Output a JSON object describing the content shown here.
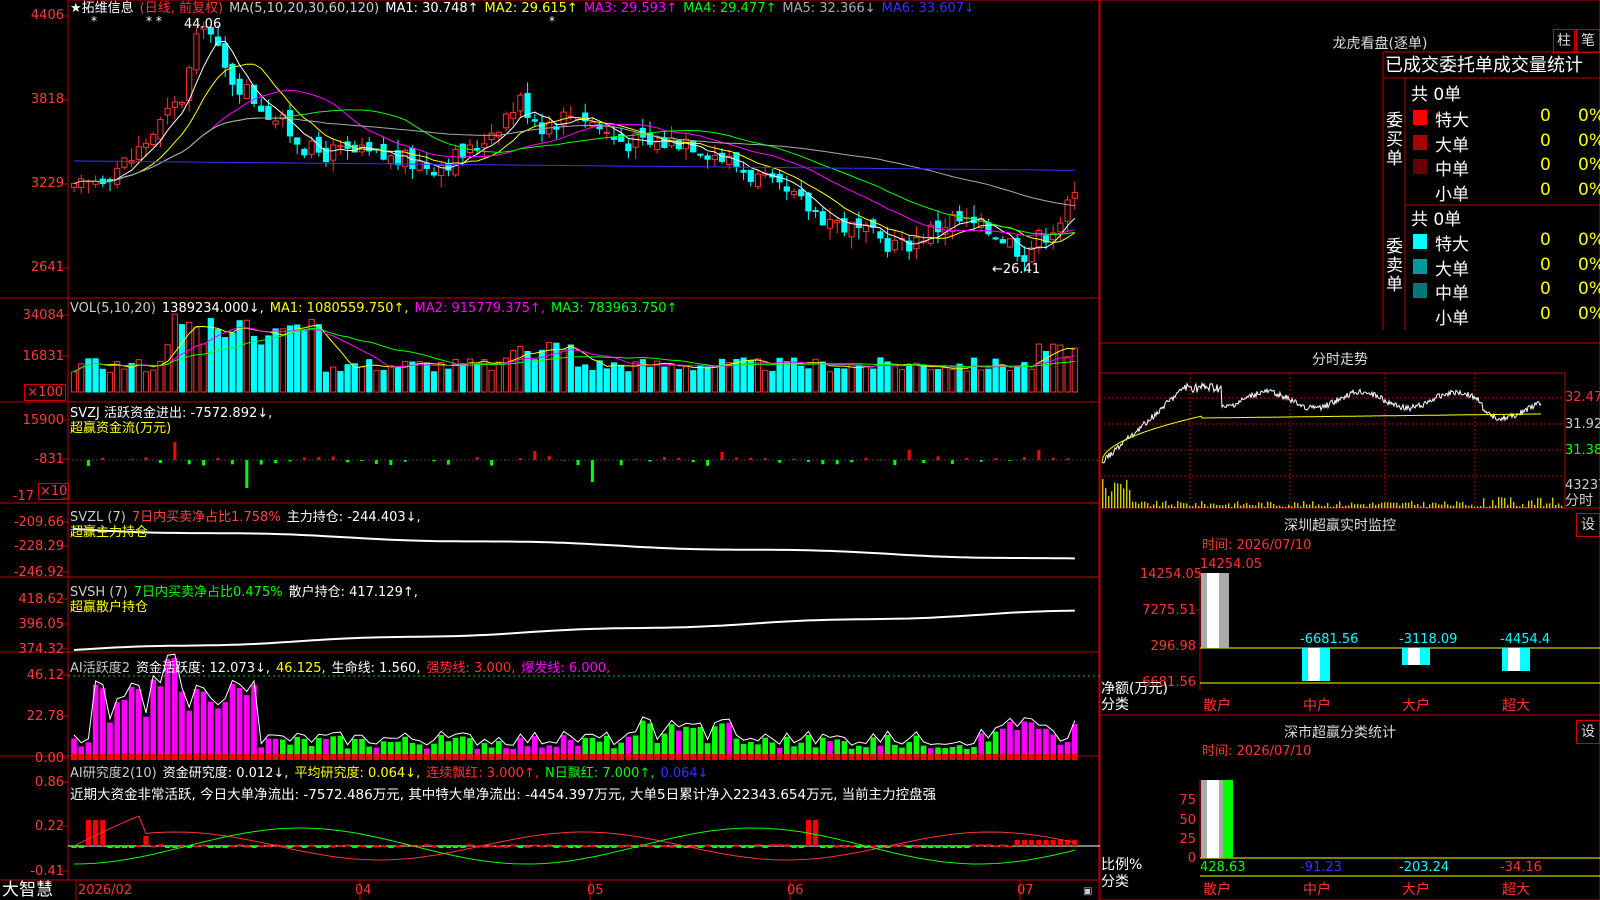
{
  "stock": {
    "name": "★拓维信息",
    "period": "(日线, 前复权)",
    "ma_label": "MA(5,10,20,30,60,120)",
    "ma": [
      {
        "t": "MA1: 30.748↑",
        "c": "#ffffff"
      },
      {
        "t": "MA2: 29.615↑",
        "c": "#ffff00"
      },
      {
        "t": "MA3: 29.593↑",
        "c": "#ff00ff"
      },
      {
        "t": "MA4: 29.477↑",
        "c": "#00ff00"
      },
      {
        "t": "MA5: 32.366↓",
        "c": "#aaaaaa"
      },
      {
        "t": "MA6: 33.607↓",
        "c": "#3333ff"
      }
    ],
    "hi_label": "44.06",
    "lo_label": "←26.41",
    "stars": "* *"
  },
  "axes": {
    "price": [
      "4406",
      "3818",
      "3229",
      "2641"
    ],
    "vol": [
      "34084",
      "16831",
      "×100"
    ],
    "svzj": [
      "15900",
      "-831",
      "-17",
      "×10"
    ],
    "svzl": [
      "-209.66",
      "-228.29",
      "-246.92"
    ],
    "svsh": [
      "418.62",
      "396.05",
      "374.32"
    ],
    "ai1": [
      "46.12",
      "22.78",
      "0.00"
    ],
    "ai2": [
      "0.86",
      "0.22",
      "-0.41"
    ]
  },
  "vol_hdr": [
    {
      "t": "VOL(5,10,20)",
      "c": "#cccccc"
    },
    {
      "t": "1389234.000↓,",
      "c": "#ffffff"
    },
    {
      "t": "MA1: 1080559.750↑,",
      "c": "#ffff00"
    },
    {
      "t": "MA2: 915779.375↑,",
      "c": "#ff00ff"
    },
    {
      "t": "MA3: 783963.750↑",
      "c": "#00ff00"
    }
  ],
  "svzj_hdr": [
    {
      "t": "SVZJ  活跃资金进出: -7572.892↓,",
      "c": "#ffffff"
    }
  ],
  "svzj_sub": "超赢资金流(万元)",
  "svzl_hdr": [
    {
      "t": "SVZL (7)",
      "c": "#cccccc"
    },
    {
      "t": "7日内买卖净占比1.758%",
      "c": "#ff4444"
    },
    {
      "t": "主力持仓: -244.403↓,",
      "c": "#ffffff"
    }
  ],
  "svzl_sub": "超赢主力持仓",
  "svsh_hdr": [
    {
      "t": "SVSH (7)",
      "c": "#cccccc"
    },
    {
      "t": "7日内买卖净占比0.475%",
      "c": "#00ff00"
    },
    {
      "t": "散户持仓: 417.129↑,",
      "c": "#ffffff"
    }
  ],
  "svsh_sub": "超赢散户持仓",
  "ai1_hdr": [
    {
      "t": "AI活跃度2",
      "c": "#cccccc"
    },
    {
      "t": "资金活跃度: 12.073↓,",
      "c": "#ffffff"
    },
    {
      "t": "46.125,",
      "c": "#ffff00"
    },
    {
      "t": "生命线: 1.560,",
      "c": "#ffffff"
    },
    {
      "t": "强势线: 3.000,",
      "c": "#ff3333"
    },
    {
      "t": "爆发线: 6.000,",
      "c": "#ff00ff"
    }
  ],
  "ai2_hdr": [
    {
      "t": "AI研究度2(10)",
      "c": "#cccccc"
    },
    {
      "t": "资金研究度: 0.012↓,",
      "c": "#ffffff"
    },
    {
      "t": "平均研究度: 0.064↓,",
      "c": "#ffff00"
    },
    {
      "t": "连续飘红: 3.000↑,",
      "c": "#ff3333"
    },
    {
      "t": "N日飘红: 7.000↑,",
      "c": "#00ff00"
    },
    {
      "t": "0.064↓",
      "c": "#3333ff"
    }
  ],
  "ai2_text": "近期大资金非常活跃, 今日大单净流出: -7572.486万元, 其中特大单净流出: -4454.397万元, 大单5日累计净入22343.654万元, 当前主力控盘强",
  "dates": [
    "2026/02",
    "04",
    "05",
    "06",
    "07"
  ],
  "brand": "大智慧",
  "dragon": {
    "title": "龙虎看盘(逐单)",
    "btn1": "柱",
    "btn2": "笔",
    "tabs": "已成交委托单成交量统计",
    "buy_label": "委买单",
    "sell_label": "委卖单",
    "buy_total": "共 0单",
    "sell_total": "共 0单",
    "rows": [
      {
        "n": "特大",
        "v": "0",
        "p": "0%"
      },
      {
        "n": "大单",
        "v": "0",
        "p": "0%"
      },
      {
        "n": "中单",
        "v": "0",
        "p": "0%"
      },
      {
        "n": "小单",
        "v": "0",
        "p": "0%"
      }
    ],
    "buy_colors": [
      "#ff0000",
      "#aa0000",
      "#660000",
      "#000000"
    ],
    "sell_colors": [
      "#00ffff",
      "#009999",
      "#007777",
      "#000000"
    ]
  },
  "intraday": {
    "title": "分时走势",
    "p1": "32.47",
    "p2": "31.92",
    "p3": "31.38",
    "vol": "43237",
    "unit": "分时"
  },
  "sz_monitor": {
    "title": "深圳超赢实时监控",
    "btn": "设",
    "time": "时间: 2026/07/10",
    "y": [
      "14254.05",
      "7275.51",
      "296.98",
      "-6681.56"
    ],
    "vals": [
      "14254.05",
      "-6681.56",
      "-3118.09",
      "-4454.4"
    ],
    "ylabel1": "净额(万元)",
    "ylabel2": "分类",
    "cats": [
      "散户",
      "中户",
      "大户",
      "超大"
    ]
  },
  "sz_class": {
    "title": "深市超赢分类统计",
    "btn": "设",
    "time": "时间: 2026/07/10",
    "y": [
      "75",
      "50",
      "25",
      "0"
    ],
    "vals": [
      "428.63",
      "-91.23",
      "-203.24",
      "-34.16"
    ],
    "ylabel1": "比例%",
    "ylabel2": "分类",
    "cats": [
      "散户",
      "中户",
      "大户",
      "超大"
    ]
  }
}
